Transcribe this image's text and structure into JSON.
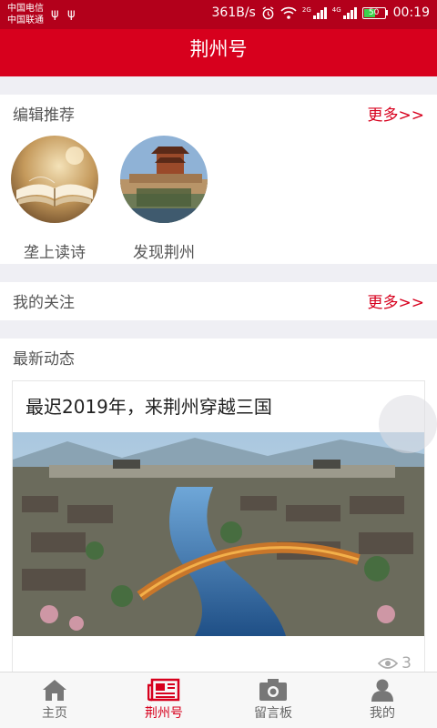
{
  "status_bar": {
    "carrier_1": "中国电信",
    "carrier_2": "中国联通",
    "net_speed": "361B/s",
    "battery": "50",
    "time": "00:19",
    "signal_1_type": "2G",
    "signal_2_type": "4G"
  },
  "header": {
    "title": "荆州号"
  },
  "editor_section": {
    "title": "编辑推荐",
    "more": "更多>>",
    "items": [
      {
        "label": "垄上读诗",
        "icon": "open-book"
      },
      {
        "label": "发现荆州",
        "icon": "city-gate"
      }
    ]
  },
  "follow_section": {
    "title": "我的关注",
    "more": "更多>>"
  },
  "news_section": {
    "title": "最新动态",
    "card": {
      "title": "最迟2019年，来荆州穿越三国",
      "views": "3"
    }
  },
  "bottom_nav": {
    "items": [
      {
        "label": "主页",
        "icon": "home-icon",
        "active": false
      },
      {
        "label": "荆州号",
        "icon": "newspaper-icon",
        "active": true
      },
      {
        "label": "留言板",
        "icon": "camera-icon",
        "active": false
      },
      {
        "label": "我的",
        "icon": "person-icon",
        "active": false
      }
    ]
  },
  "colors": {
    "brand_red": "#d7001d",
    "status_bar_red": "#b3001b",
    "page_bg": "#efeff4"
  }
}
